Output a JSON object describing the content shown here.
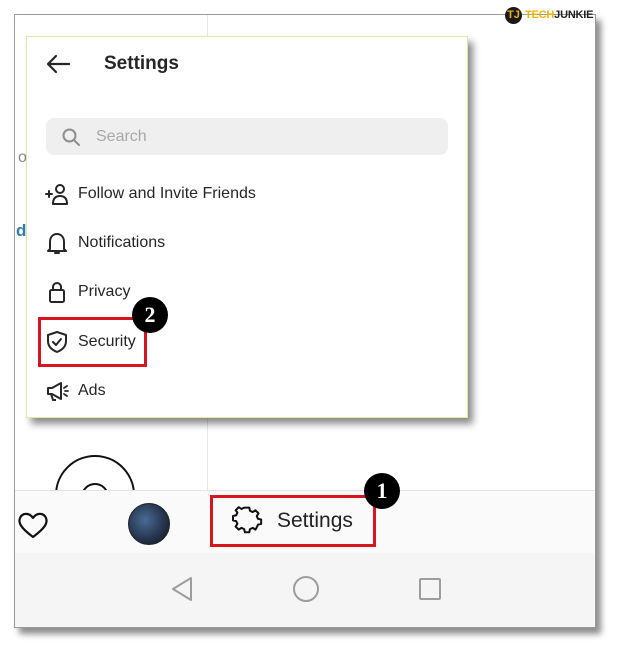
{
  "watermark": {
    "brand_part1": "TECH",
    "brand_part2": "JUNKIE",
    "mark": "TJ"
  },
  "popup": {
    "title": "Settings",
    "search_placeholder": "Search",
    "items": [
      {
        "label": "Follow and Invite Friends",
        "icon": "add-person-icon"
      },
      {
        "label": "Notifications",
        "icon": "bell-icon"
      },
      {
        "label": "Privacy",
        "icon": "lock-icon"
      },
      {
        "label": "Security",
        "icon": "shield-check-icon"
      },
      {
        "label": "Ads",
        "icon": "megaphone-icon"
      }
    ]
  },
  "background": {
    "partial_text_1": "o",
    "partial_text_2": "d"
  },
  "bottom_bar": {
    "settings_label": "Settings"
  },
  "steps": {
    "step1": "1",
    "step2": "2"
  },
  "colors": {
    "highlight": "#d8141f",
    "brand_yellow": "#f2b200",
    "link_blue": "#2f7fb2"
  }
}
